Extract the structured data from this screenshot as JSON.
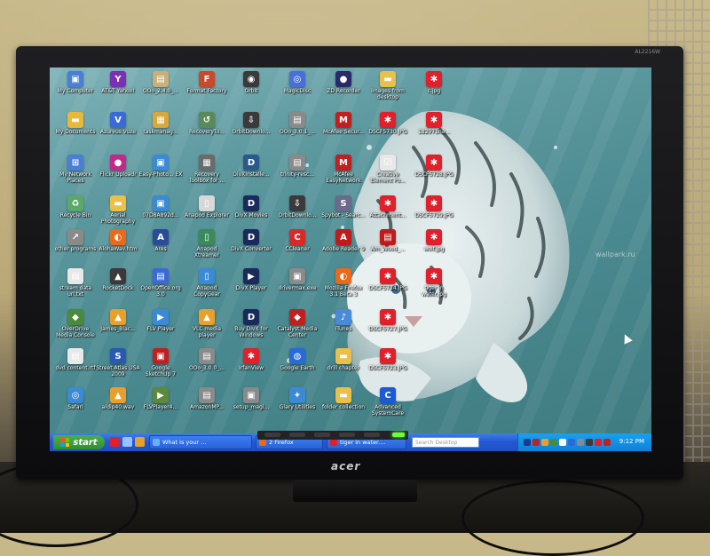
{
  "window": {
    "brand": "acer",
    "model": "AL2216W"
  },
  "wallpaper": {
    "watermark": "wallpark.ru",
    "description_icon": "white-tiger-underwater-wallpaper"
  },
  "desktop": {
    "icons": [
      {
        "label": "My Computer",
        "color": "#4a7fd6",
        "icon": "computer-icon",
        "glyph": "▣"
      },
      {
        "label": "AT&T Yahoo!",
        "color": "#7b2fb5",
        "icon": "yahoo-icon",
        "glyph": "Y"
      },
      {
        "label": "OOo_2.4.0_...",
        "color": "#c9b07a",
        "icon": "package-icon",
        "glyph": "▤"
      },
      {
        "label": "Format Factory",
        "color": "#c84a2a",
        "icon": "format-factory-icon",
        "glyph": "F"
      },
      {
        "label": "Orbit",
        "color": "#3a3a3a",
        "icon": "orbit-icon",
        "glyph": "◉"
      },
      {
        "label": "MagicDisc",
        "color": "#4a6fd6",
        "icon": "disc-icon",
        "glyph": "◎"
      },
      {
        "label": "ZD Recorder",
        "color": "#2a2a6a",
        "icon": "recorder-icon",
        "glyph": "●"
      },
      {
        "label": "images from desktop",
        "color": "#e8c04a",
        "icon": "folder-icon",
        "glyph": "▬"
      },
      {
        "label": "c.jpg",
        "color": "#e0202a",
        "icon": "image-file-icon",
        "glyph": "✱"
      },
      {
        "label": "My Documents",
        "color": "#e8b83a",
        "icon": "documents-icon",
        "glyph": "▬"
      },
      {
        "label": "Azureus Vuze",
        "color": "#3a6ad6",
        "icon": "vuze-icon",
        "glyph": "V"
      },
      {
        "label": "taskmanag...",
        "color": "#d8a83a",
        "icon": "task-manager-icon",
        "glyph": "▦"
      },
      {
        "label": "RecoveryTo...",
        "color": "#5a8a5a",
        "icon": "recovery-icon",
        "glyph": "↺"
      },
      {
        "label": "OrbitDownlo...",
        "color": "#3a3a3a",
        "icon": "orbit-download-icon",
        "glyph": "⇩"
      },
      {
        "label": "OOo_3.0.1_...",
        "color": "#8a8a8a",
        "icon": "package-icon",
        "glyph": "▤"
      },
      {
        "label": "McAfee Secur...",
        "color": "#c02020",
        "icon": "mcafee-icon",
        "glyph": "M"
      },
      {
        "label": "DSCF5730.JPG",
        "color": "#e0202a",
        "icon": "image-file-icon",
        "glyph": "✱"
      },
      {
        "label": "182971na...",
        "color": "#e0202a",
        "icon": "image-file-icon",
        "glyph": "✱"
      },
      {
        "label": "My Network Places",
        "color": "#4a7fd6",
        "icon": "network-icon",
        "glyph": "⊞"
      },
      {
        "label": "Flickr Uploadr",
        "color": "#c02a8a",
        "icon": "flickr-icon",
        "glyph": "●"
      },
      {
        "label": "Easy-Photo... EX",
        "color": "#3a8ad6",
        "icon": "photo-icon",
        "glyph": "▣"
      },
      {
        "label": "Recovery Toolbox for ...",
        "color": "#6a6a6a",
        "icon": "toolbox-icon",
        "glyph": "▦"
      },
      {
        "label": "DivXInstalle...",
        "color": "#2a5a8a",
        "icon": "divx-icon",
        "glyph": "D"
      },
      {
        "label": "trinity-resc...",
        "color": "#8a8a8a",
        "icon": "archive-icon",
        "glyph": "▤"
      },
      {
        "label": "McAfee EasyNetwork",
        "color": "#c02020",
        "icon": "mcafee-icon",
        "glyph": "M"
      },
      {
        "label": "Creative Element Po...",
        "color": "#e8e8e8",
        "icon": "creative-icon",
        "glyph": "☑"
      },
      {
        "label": "DSCF5728.JPG",
        "color": "#e0202a",
        "icon": "image-file-icon",
        "glyph": "✱"
      },
      {
        "label": "Recycle Bin",
        "color": "#5aa86a",
        "icon": "recycle-bin-icon",
        "glyph": "♻"
      },
      {
        "label": "Aerial Photography",
        "color": "#e8c04a",
        "icon": "folder-icon",
        "glyph": "▬"
      },
      {
        "label": "07D8A892d...",
        "color": "#3a8ad6",
        "icon": "file-icon",
        "glyph": "▣"
      },
      {
        "label": "Anapod Explorer",
        "color": "#d8d8d8",
        "icon": "anapod-icon",
        "glyph": "▯"
      },
      {
        "label": "DivX Movies",
        "color": "#1a2a5a",
        "icon": "divx-movies-icon",
        "glyph": "D"
      },
      {
        "label": "OrbitDownlo...",
        "color": "#3a3a3a",
        "icon": "orbit-download-icon",
        "glyph": "⇩"
      },
      {
        "label": "Spybot - Searc...",
        "color": "#6a6a8a",
        "icon": "spybot-icon",
        "glyph": "S"
      },
      {
        "label": "Attachment...",
        "color": "#e0202a",
        "icon": "attachment-icon",
        "glyph": "✱"
      },
      {
        "label": "DSCF5729.JPG",
        "color": "#e0202a",
        "icon": "image-file-icon",
        "glyph": "✱"
      },
      {
        "label": "other programs",
        "color": "#8a8a8a",
        "icon": "shortcut-icon",
        "glyph": "↗"
      },
      {
        "label": "AlohaWav.htm",
        "color": "#e86a1a",
        "icon": "firefox-doc-icon",
        "glyph": "◐"
      },
      {
        "label": "Ares",
        "color": "#2a4a9a",
        "icon": "ares-icon",
        "glyph": "A"
      },
      {
        "label": "Anapod Xtreamer",
        "color": "#3a8a5a",
        "icon": "anapod-icon",
        "glyph": "▯"
      },
      {
        "label": "DivX Converter",
        "color": "#1a2a5a",
        "icon": "divx-converter-icon",
        "glyph": "D"
      },
      {
        "label": "CCleaner",
        "color": "#d82a2a",
        "icon": "ccleaner-icon",
        "glyph": "C"
      },
      {
        "label": "Adobe Reader 9",
        "color": "#c01a1a",
        "icon": "adobe-reader-icon",
        "glyph": "A"
      },
      {
        "label": "Am_Wood_...",
        "color": "#c01a1a",
        "icon": "pdf-file-icon",
        "glyph": "▤"
      },
      {
        "label": "wolf.jpg",
        "color": "#e0202a",
        "icon": "image-file-icon",
        "glyph": "✱"
      },
      {
        "label": "stream data url.txt",
        "color": "#e8e8e8",
        "icon": "text-file-icon",
        "glyph": "▤"
      },
      {
        "label": "RocketDock",
        "color": "#3a3a3a",
        "icon": "rocketdock-icon",
        "glyph": "▲"
      },
      {
        "label": "OpenOffice.org 3.0",
        "color": "#3a6ad6",
        "icon": "openoffice-icon",
        "glyph": "▤"
      },
      {
        "label": "Anapod CopyGear",
        "color": "#3a8ad6",
        "icon": "anapod-icon",
        "glyph": "▯"
      },
      {
        "label": "DivX Player",
        "color": "#1a2a5a",
        "icon": "divx-player-icon",
        "glyph": "▶"
      },
      {
        "label": "drivermax.exe",
        "color": "#8a8a8a",
        "icon": "exe-icon",
        "glyph": "▣"
      },
      {
        "label": "Mozilla Firefox 3.1 Beta 3",
        "color": "#e86a1a",
        "icon": "firefox-icon",
        "glyph": "◐"
      },
      {
        "label": "DSCF5724.JPG",
        "color": "#e0202a",
        "icon": "image-file-icon",
        "glyph": "✱"
      },
      {
        "label": "tiger in water.jpg",
        "color": "#e0202a",
        "icon": "image-file-icon",
        "glyph": "✱"
      },
      {
        "label": "OverDrive Media Console",
        "color": "#4a8a3a",
        "icon": "overdrive-icon",
        "glyph": "◆"
      },
      {
        "label": "James_Blac...",
        "color": "#e8a02a",
        "icon": "vlc-file-icon",
        "glyph": "▲"
      },
      {
        "label": "FLV Player",
        "color": "#3a8ad6",
        "icon": "flv-player-icon",
        "glyph": "▶"
      },
      {
        "label": "VLC media player",
        "color": "#e8a02a",
        "icon": "vlc-icon",
        "glyph": "▲"
      },
      {
        "label": "Buy DivX for Windows",
        "color": "#1a2a5a",
        "icon": "divx-buy-icon",
        "glyph": "D"
      },
      {
        "label": "Catalyst Media Center",
        "color": "#c02020",
        "icon": "catalyst-icon",
        "glyph": "◆"
      },
      {
        "label": "iTunes",
        "color": "#4a8ad6",
        "icon": "itunes-icon",
        "glyph": "♪"
      },
      {
        "label": "DSCF5727.JPG",
        "color": "#e0202a",
        "icon": "image-file-icon",
        "glyph": "✱"
      },
      {
        "label": "dvd content.rtf",
        "color": "#e8e8e8",
        "icon": "rtf-file-icon",
        "glyph": "▤"
      },
      {
        "label": "Street Atlas USA 2009",
        "color": "#2a5ab0",
        "icon": "street-atlas-icon",
        "glyph": "S"
      },
      {
        "label": "Google SketchUp 7",
        "color": "#c02020",
        "icon": "sketchup-icon",
        "glyph": "▣"
      },
      {
        "label": "OOo_3.0.0_...",
        "color": "#8a8a8a",
        "icon": "package-icon",
        "glyph": "▤"
      },
      {
        "label": "IrfanView",
        "color": "#e0202a",
        "icon": "irfanview-icon",
        "glyph": "✱"
      },
      {
        "label": "Google Earth",
        "color": "#2a6ad6",
        "icon": "google-earth-icon",
        "glyph": "◍"
      },
      {
        "label": "drill chapter",
        "color": "#e8c04a",
        "icon": "folder-icon",
        "glyph": "▬"
      },
      {
        "label": "DSCF5723.JPG",
        "color": "#e0202a",
        "icon": "image-file-icon",
        "glyph": "✱"
      },
      {
        "label": "Safari",
        "color": "#3a8ad6",
        "icon": "safari-icon",
        "glyph": "◎"
      },
      {
        "label": "aldip40.wav",
        "color": "#e8a02a",
        "icon": "vlc-file-icon",
        "glyph": "▲"
      },
      {
        "label": "FLVPlayer4...",
        "color": "#5a8a3a",
        "icon": "flv-installer-icon",
        "glyph": "▶"
      },
      {
        "label": "AmazonMP...",
        "color": "#8a8a8a",
        "icon": "archive-icon",
        "glyph": "▤"
      },
      {
        "label": "setup_magi...",
        "color": "#8a8a8a",
        "icon": "setup-icon",
        "glyph": "▣"
      },
      {
        "label": "Glary Utilities",
        "color": "#3a8ad6",
        "icon": "glary-icon",
        "glyph": "✦"
      },
      {
        "label": "folder collection",
        "color": "#e8c04a",
        "icon": "folder-icon",
        "glyph": "▬"
      },
      {
        "label": "Advanced SystemCare",
        "color": "#1a5ad6",
        "icon": "systemcare-icon",
        "glyph": "C"
      }
    ]
  },
  "taskbar": {
    "start_label": "start",
    "quick_launch": [
      {
        "icon": "irfanview-quick-icon",
        "color": "#e0202a"
      },
      {
        "icon": "show-desktop-icon",
        "color": "#9ac0ff"
      },
      {
        "icon": "media-player-icon",
        "color": "#e8a02a"
      }
    ],
    "tasks": [
      {
        "label": "What is your ...",
        "icon": "ie-icon",
        "color": "#6ab0ff"
      },
      {
        "label": "2 Firefox",
        "icon": "firefox-icon",
        "color": "#e86a1a"
      },
      {
        "label": "tiger in water....",
        "icon": "irfanview-icon",
        "color": "#e0202a"
      }
    ],
    "search_placeholder": "Search Desktop",
    "clock": "9:12 PM"
  }
}
